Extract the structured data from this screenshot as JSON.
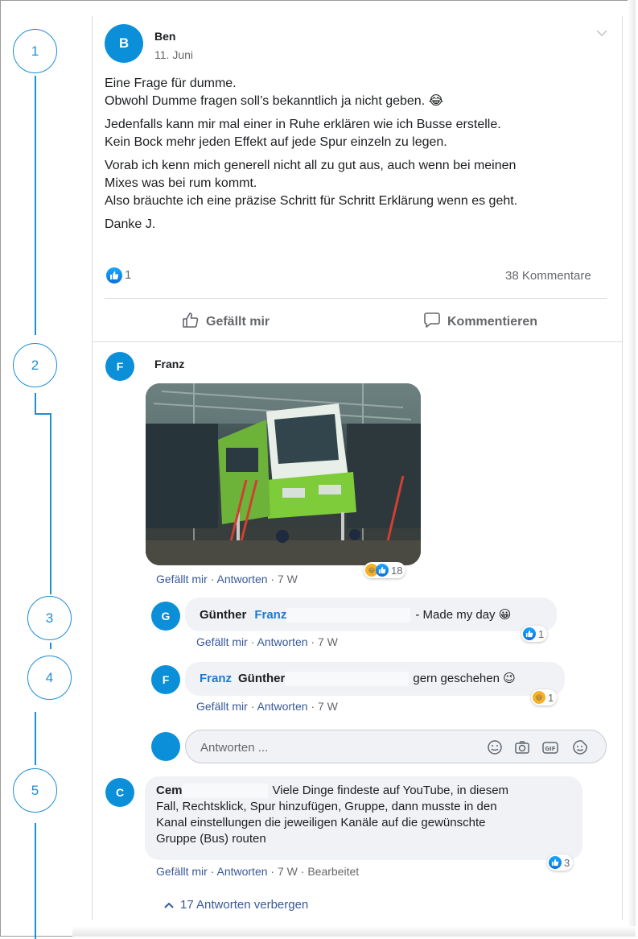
{
  "steps": [
    "1",
    "2",
    "3",
    "4",
    "5"
  ],
  "post": {
    "author_initial": "B",
    "author": "Ben",
    "date": "11. Juni",
    "paragraphs": [
      [
        "Eine Frage für dumme.",
        "Obwohl Dumme fragen soll’s bekanntlich ja nicht geben. 😂"
      ],
      [
        "Jedenfalls kann mir mal einer in Ruhe erklären wie ich Busse erstelle.",
        "Kein Bock mehr jeden Effekt auf jede Spur einzeln zu legen."
      ],
      [
        "Vorab ich kenn mich generell nicht all zu gut aus, auch wenn bei meinen",
        "Mixes was bei rum kommt.",
        "Also bräuchte ich eine präzise Schritt für Schritt Erklärung wenn es geht."
      ],
      [
        "Danke J."
      ]
    ],
    "likes": "1",
    "comments_count": "38 Kommentare",
    "like_action": "Gefällt mir",
    "comment_action": "Kommentieren"
  },
  "comments": {
    "franz": {
      "initial": "F",
      "name": "Franz",
      "reactions": "18",
      "like": "Gefällt mir",
      "reply": "Antworten",
      "time": "7 W",
      "sep": "·"
    },
    "guenther": {
      "initial": "G",
      "name": "Günther",
      "mention": "Franz",
      "text": "- Made my day 😀",
      "reactions": "1",
      "like": "Gefällt mir",
      "reply": "Antworten",
      "time": "7 W",
      "sep": "·"
    },
    "franz_reply": {
      "initial": "F",
      "name": "Franz",
      "mention": "Günther",
      "text": "gern geschehen 😉",
      "reactions": "1",
      "like": "Gefällt mir",
      "reply": "Antworten",
      "time": "7 W",
      "sep": "·"
    },
    "reply_input": {
      "placeholder": "Antworten ..."
    },
    "cem": {
      "initial": "C",
      "name": "Cem",
      "first_line": "Viele Dinge findeste auf YouTube, in diesem",
      "lines": [
        "Fall, Rechtsklick, Spur hinzufügen, Gruppe, dann musste in den",
        "Kanal einstellungen die jeweiligen Kanäle auf die gewünschte",
        "Gruppe (Bus) routen"
      ],
      "reactions": "3",
      "like": "Gefällt mir",
      "reply": "Antworten",
      "time": "7 W",
      "edited": "Bearbeitet",
      "sep": "·"
    },
    "hide_replies": "17 Antworten verbergen"
  },
  "colors": {
    "accent": "#1e8fd6",
    "avatar": "#0a8fd8",
    "link": "#385898",
    "like_blue": "#1877f2"
  }
}
